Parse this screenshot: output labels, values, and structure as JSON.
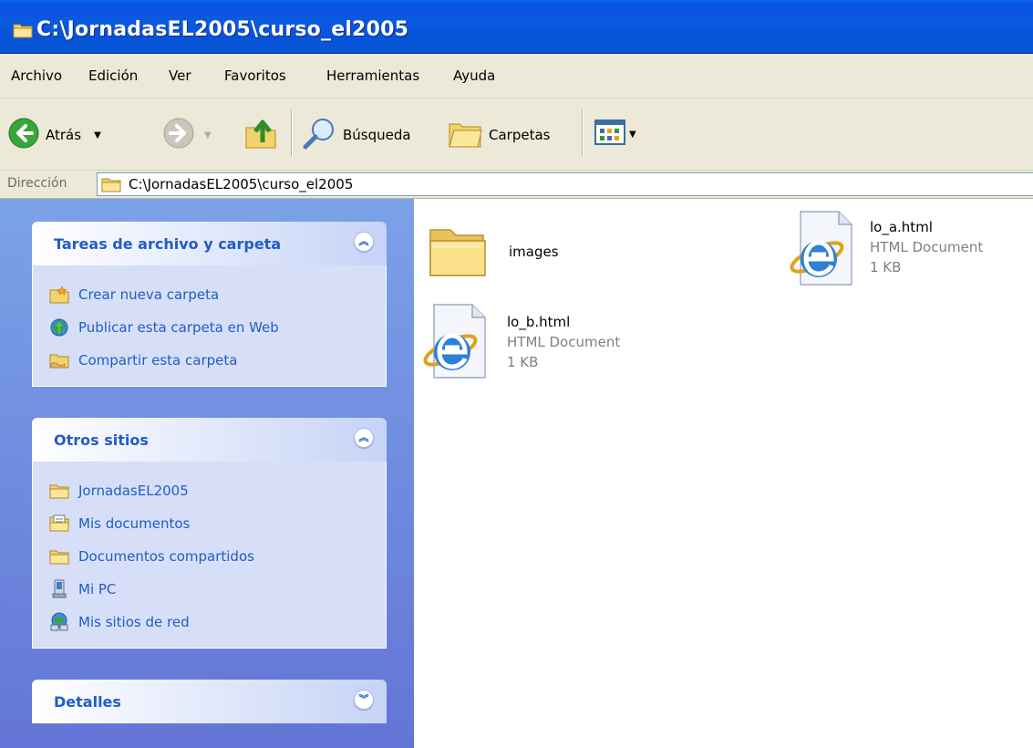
{
  "window": {
    "title": "C:\\JornadasEL2005\\curso_el2005"
  },
  "menu": {
    "items": [
      "Archivo",
      "Edición",
      "Ver",
      "Favoritos",
      "Herramientas",
      "Ayuda"
    ]
  },
  "toolbar": {
    "back_label": "Atrás",
    "search_label": "Búsqueda",
    "folders_label": "Carpetas"
  },
  "address": {
    "label": "Dirección",
    "value": "C:\\JornadasEL2005\\curso_el2005"
  },
  "tasks_panel": {
    "title": "Tareas de archivo y carpeta",
    "items": [
      {
        "label": "Crear nueva carpeta",
        "icon": "new-folder-icon"
      },
      {
        "label": "Publicar esta carpeta en Web",
        "icon": "publish-web-icon"
      },
      {
        "label": "Compartir esta carpeta",
        "icon": "share-folder-icon"
      }
    ]
  },
  "other_places_panel": {
    "title": "Otros sitios",
    "items": [
      {
        "label": "JornadasEL2005",
        "icon": "folder-icon"
      },
      {
        "label": "Mis documentos",
        "icon": "my-documents-icon"
      },
      {
        "label": "Documentos compartidos",
        "icon": "folder-icon"
      },
      {
        "label": "Mi PC",
        "icon": "my-computer-icon"
      },
      {
        "label": "Mis sitios de red",
        "icon": "network-places-icon"
      }
    ]
  },
  "details_panel": {
    "title": "Detalles"
  },
  "files": [
    {
      "name": "images",
      "type": "folder",
      "icon": "folder-icon"
    },
    {
      "name": "lo_a.html",
      "kind": "HTML Document",
      "size": "1 KB",
      "icon": "ie-document-icon"
    },
    {
      "name": "lo_b.html",
      "kind": "HTML Document",
      "size": "1 KB",
      "icon": "ie-document-icon"
    }
  ],
  "colors": {
    "titlebar": "#0853e6",
    "chrome": "#ece9d8",
    "pane_link": "#215dc6",
    "pane_background": "#d6dff7"
  }
}
